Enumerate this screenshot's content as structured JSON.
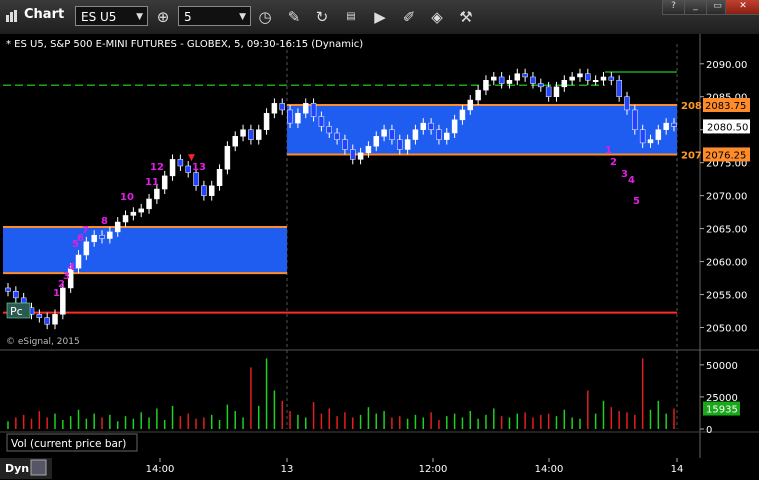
{
  "window": {
    "title": "Chart"
  },
  "toolbar": {
    "symbol": "ES U5",
    "interval": "5",
    "icons": [
      "crosshair-target-icon",
      "clock-icon",
      "pencil-icon",
      "refresh-icon",
      "news-icon",
      "play-icon",
      "eraser-icon",
      "tag-icon",
      "hammer-icon"
    ]
  },
  "chart_data": {
    "type": "candlestick",
    "title": "* ES U5, S&P 500 E-MINI FUTURES - GLOBEX, 5, 09:30-16:15 (Dynamic)",
    "copyright": "© eSignal, 2015",
    "last_price": "2080.50",
    "ylim": [
      2047.5,
      2093
    ],
    "yticks": [
      "2090.00",
      "2085.00",
      "2080.00",
      "2075.00",
      "2070.00",
      "2065.00",
      "2060.00",
      "2055.00",
      "2050.00"
    ],
    "xticks": [
      "14:00",
      "13",
      "12:00",
      "14:00",
      "14"
    ],
    "zones": [
      {
        "top": 2065.25,
        "bottom": 2058.25,
        "color": "#1f5cf0"
      },
      {
        "top": 2083.75,
        "bottom": 2076.25,
        "color": "#1f5cf0"
      }
    ],
    "levels": [
      {
        "price": 2083.75,
        "label": "2083.75",
        "side": "208"
      },
      {
        "price": 2076.25,
        "label": "2076.25",
        "side": "207"
      }
    ],
    "green_line": 2086.75,
    "green_line_right": 2088.75,
    "red_line": 2052.25,
    "pc_label": "Pc",
    "magenta_labels": [
      "1",
      "2",
      "3",
      "4",
      "5",
      "6",
      "7",
      "8",
      "10",
      "11",
      "12",
      "13"
    ],
    "right_labels": [
      "1",
      "2",
      "3",
      "4",
      "5"
    ],
    "closes": [
      2055.5,
      2054.5,
      2053,
      2052,
      2051.5,
      2050.5,
      2052,
      2056,
      2059,
      2061,
      2063,
      2064,
      2063.5,
      2064.5,
      2066,
      2067,
      2067.5,
      2068,
      2069.5,
      2071,
      2073,
      2075.5,
      2074.5,
      2073.5,
      2071.5,
      2070,
      2071.5,
      2074,
      2077.5,
      2079,
      2080,
      2078.5,
      2080,
      2082.5,
      2084,
      2083,
      2081,
      2082.5,
      2084,
      2082,
      2080.5,
      2079.5,
      2078.5,
      2077,
      2075.5,
      2076.5,
      2077.5,
      2079,
      2080,
      2078.5,
      2077,
      2078.5,
      2080,
      2081,
      2080,
      2078.5,
      2079.5,
      2081.5,
      2083,
      2084.5,
      2086,
      2087.5,
      2088,
      2087,
      2087.5,
      2088.5,
      2088,
      2087,
      2086.5,
      2085,
      2086.5,
      2087.5,
      2088,
      2088.5,
      2087.5,
      2087.5,
      2088,
      2087.5,
      2085,
      2083,
      2080,
      2078,
      2078.5,
      2080,
      2081,
      2080.5
    ]
  },
  "volume": {
    "label": "Vol (current price bar)",
    "value": "15935",
    "yticks": [
      "50000",
      "25000",
      "0"
    ],
    "ylim": [
      0,
      60000
    ],
    "bars": [
      6000,
      9000,
      11000,
      8000,
      14000,
      9000,
      12000,
      7000,
      10000,
      15000,
      8000,
      12000,
      9000,
      11000,
      6000,
      10000,
      8000,
      13000,
      9000,
      16000,
      7000,
      18000,
      10000,
      12000,
      8000,
      9000,
      11000,
      7000,
      19000,
      14000,
      9000,
      48000,
      18000,
      55000,
      30000,
      22000,
      14000,
      11000,
      9000,
      21000,
      12000,
      16000,
      10000,
      13000,
      9000,
      11000,
      17000,
      12000,
      14000,
      9000,
      10000,
      8000,
      11000,
      9000,
      13000,
      7000,
      10000,
      12000,
      9000,
      14000,
      8000,
      11000,
      16000,
      10000,
      9000,
      12000,
      13000,
      9000,
      11000,
      12000,
      10000,
      15000,
      9000,
      8000,
      30000,
      12000,
      22000,
      17000,
      14000,
      13000,
      11000,
      55000,
      15000,
      22000,
      12000,
      15935
    ]
  },
  "status": {
    "mode": "Dyn"
  }
}
